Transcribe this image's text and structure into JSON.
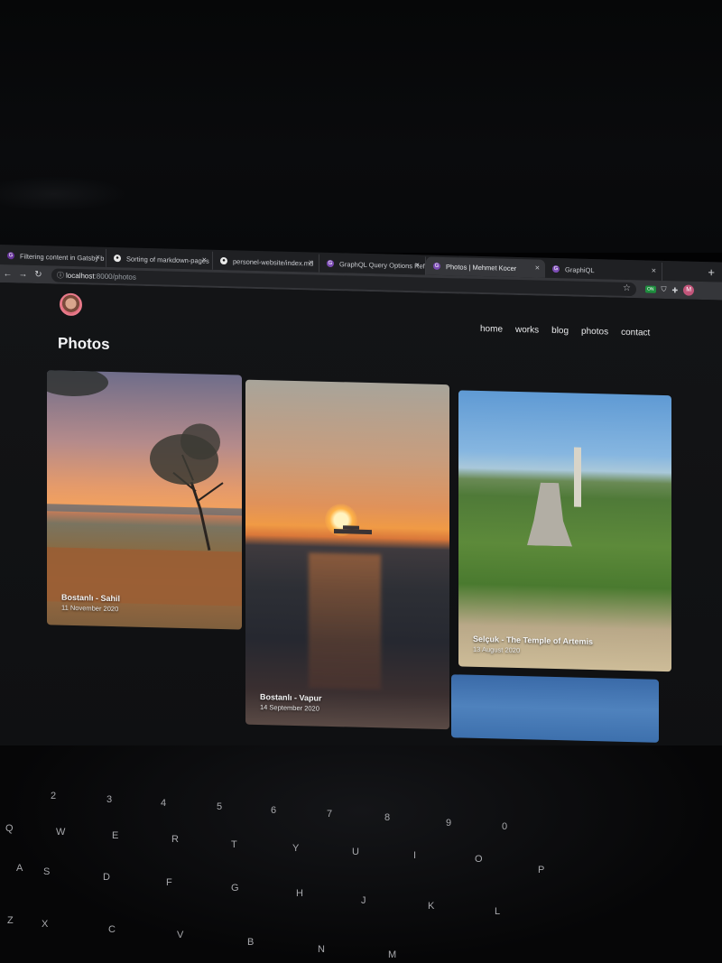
{
  "browser": {
    "tabs": [
      {
        "title": "Filtering content in Gatsby b",
        "icon": "gatsby-icon"
      },
      {
        "title": "Sorting of markdown-pages",
        "icon": "github-icon"
      },
      {
        "title": "personel-website/index.md",
        "icon": "github-icon"
      },
      {
        "title": "GraphQL Query Options Ref",
        "icon": "gatsby-icon"
      },
      {
        "title": "Photos | Mehmet Kocer",
        "icon": "gatsby-icon",
        "active": true
      },
      {
        "title": "GraphiQL",
        "icon": "graphiql-icon"
      }
    ],
    "close_glyph": "×",
    "new_tab_glyph": "+",
    "url_host": "localhost",
    "url_rest": ":8000/photos",
    "extension_badge": "ON",
    "profile_initial": "M"
  },
  "site": {
    "nav": [
      "home",
      "works",
      "blog",
      "photos",
      "contact"
    ],
    "page_title": "Photos",
    "photos": [
      {
        "caption": "Bostanlı - Sahil",
        "date": "11 November 2020"
      },
      {
        "caption": "Bostanlı - Vapur",
        "date": "14 September 2020"
      },
      {
        "caption": "Selçuk - The Temple of Artemis",
        "date": "13 August 2020"
      }
    ]
  },
  "keyboard": {
    "keys": [
      "Q",
      "W",
      "E",
      "R",
      "T",
      "Y",
      "U",
      "I",
      "O",
      "P",
      "A",
      "S",
      "D",
      "F",
      "G",
      "H",
      "J",
      "K",
      "L",
      "Z",
      "X",
      "C",
      "V",
      "B",
      "N",
      "M",
      "2",
      "3",
      "4",
      "5",
      "6",
      "7",
      "8",
      "9",
      "0"
    ]
  }
}
